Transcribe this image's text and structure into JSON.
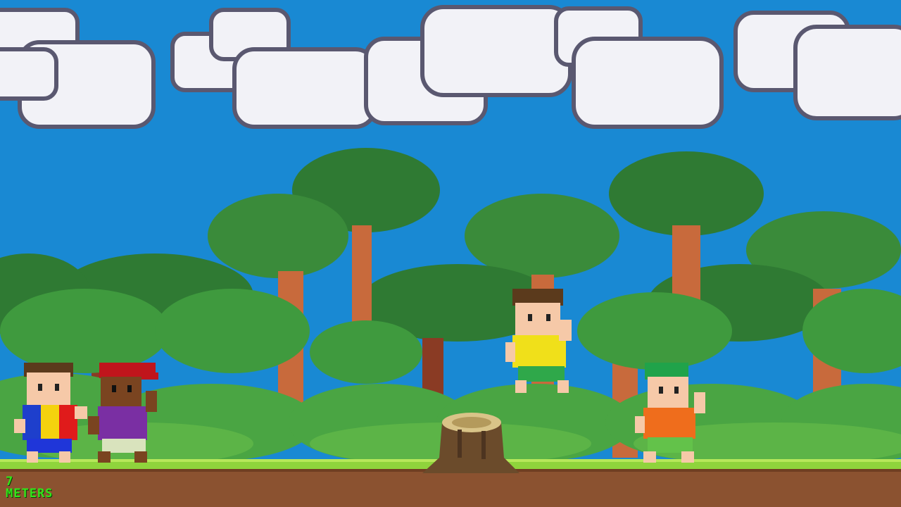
{
  "hud": {
    "distance_value": "7",
    "distance_unit": "METERS"
  },
  "colors": {
    "sky": "#1989d3",
    "cloud": "#f2f2f7",
    "cloud_outline": "#5a5870",
    "foliage_dark": "#2f7a33",
    "foliage_mid": "#3f9a3e",
    "foliage_light": "#5cb447",
    "trunk": "#c86a3c",
    "trunk_dark": "#8a3b24",
    "grass": "#8fd43c",
    "dirt": "#8b5230",
    "hud_text": "#33e41a"
  },
  "characters": [
    {
      "id": "player-runner",
      "hair": "brown",
      "shirt": "flag",
      "shorts": "blue"
    },
    {
      "id": "red-cap-runner",
      "hair": "red-cap",
      "shirt": "purple",
      "shorts": "beige"
    },
    {
      "id": "jumping-runner",
      "hair": "brown",
      "shirt": "yellow",
      "shorts": "green"
    },
    {
      "id": "green-hair-runner",
      "hair": "green",
      "shirt": "orange",
      "shorts": "green"
    }
  ],
  "obstacles": [
    {
      "id": "tree-stump",
      "kind": "stump"
    }
  ]
}
